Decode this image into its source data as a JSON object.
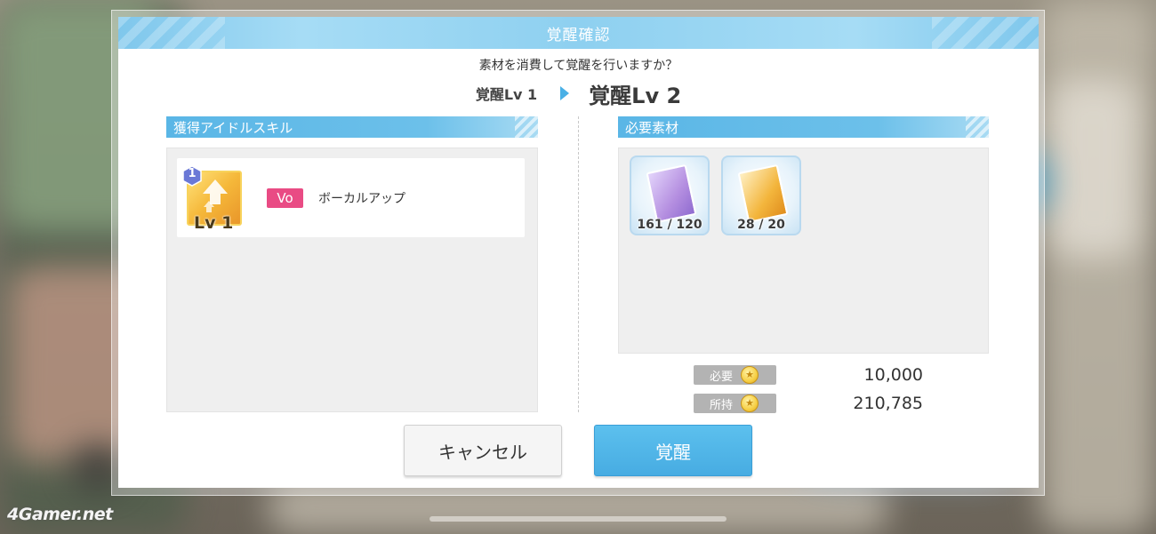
{
  "dialog": {
    "title": "覚醒確認",
    "question": "素材を消費して覚醒を行いますか？",
    "level_from": "覚醒Lv 1",
    "level_to": "覚醒Lv 2"
  },
  "skill_section": {
    "header": "獲得アイドルスキル",
    "skill": {
      "badge": "1",
      "icon_level": "Lv 1",
      "type_tag": "Vo",
      "name": "ボーカルアップ",
      "icon": "arrow-up-icon"
    }
  },
  "materials_section": {
    "header": "必要素材",
    "items": [
      {
        "quantity": "161 / 120",
        "icon": "purple-book-icon",
        "color": "#b48ee0"
      },
      {
        "quantity": "28 / 20",
        "icon": "gold-book-icon",
        "color": "#f3b53c"
      }
    ]
  },
  "cost": {
    "required_label": "必要",
    "required_value": "10,000",
    "owned_label": "所持",
    "owned_value": "210,785",
    "currency_icon": "coin-icon"
  },
  "buttons": {
    "cancel": "キャンセル",
    "awaken": "覚醒"
  },
  "watermark": "4Gamer.net",
  "colors": {
    "accent": "#4ab0e6",
    "vo_tag": "#e94b84",
    "header": "#7fc7ec"
  }
}
